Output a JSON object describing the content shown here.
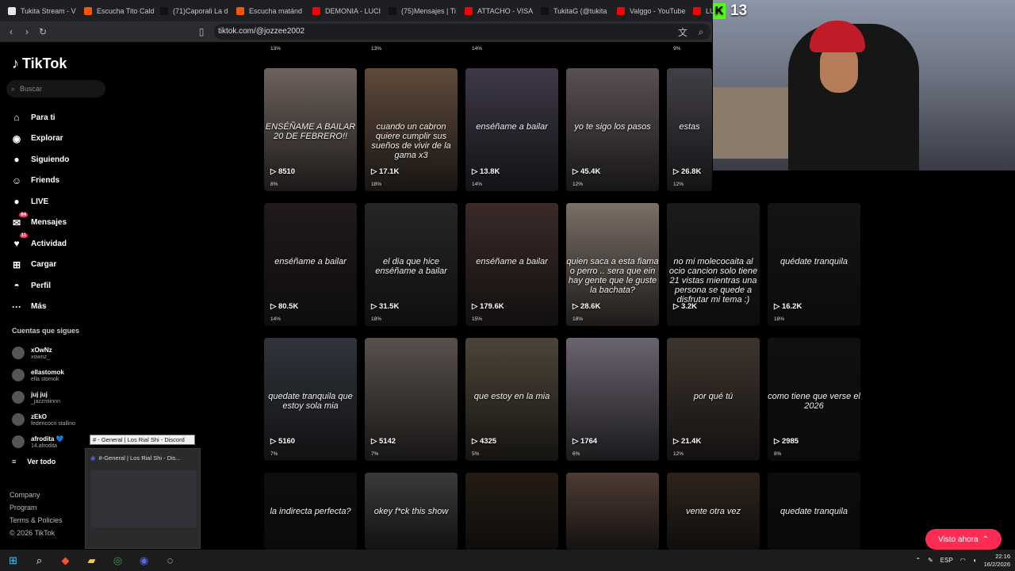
{
  "browser": {
    "tabs": [
      {
        "label": "Tukita Stream - V",
        "color": "#e6e6e6"
      },
      {
        "label": "Escucha Tito Cald",
        "color": "#ff5500"
      },
      {
        "label": "(71)Caporali La d",
        "color": "#111111"
      },
      {
        "label": "Escucha matánd",
        "color": "#ff5500"
      },
      {
        "label": "DEMONIA - LUCI",
        "color": "#ff0000"
      },
      {
        "label": "(75)Mensajes | Ti",
        "color": "#111111"
      },
      {
        "label": "ATTACHO - VISA",
        "color": "#ff0000"
      },
      {
        "label": "TukitaG (@tukita",
        "color": "#111111"
      },
      {
        "label": "Valggo - YouTube",
        "color": "#ff0000"
      },
      {
        "label": "LUAR",
        "color": "#ff0000"
      }
    ],
    "url": "tiktok.com/@jozzee2002"
  },
  "sidebar": {
    "logo": "TikTok",
    "search_placeholder": "Buscar",
    "menu": [
      {
        "label": "Para ti",
        "icon": "home-icon",
        "glyph": "⌂",
        "badge": ""
      },
      {
        "label": "Explorar",
        "icon": "compass-icon",
        "glyph": "◉",
        "badge": ""
      },
      {
        "label": "Siguiendo",
        "icon": "following-icon",
        "glyph": "●",
        "badge": ""
      },
      {
        "label": "Friends",
        "icon": "friends-icon",
        "glyph": "☺",
        "badge": ""
      },
      {
        "label": "LIVE",
        "icon": "live-icon",
        "glyph": "●",
        "badge": ""
      },
      {
        "label": "Mensajes",
        "icon": "messages-icon",
        "glyph": "✉",
        "badge": "64"
      },
      {
        "label": "Actividad",
        "icon": "activity-icon",
        "glyph": "♥",
        "badge": "11"
      },
      {
        "label": "Cargar",
        "icon": "upload-icon",
        "glyph": "⊞",
        "badge": ""
      },
      {
        "label": "Perfil",
        "icon": "profile-icon",
        "glyph": "◓",
        "badge": ""
      },
      {
        "label": "Más",
        "icon": "more-icon",
        "glyph": "···",
        "badge": ""
      }
    ],
    "following_title": "Cuentas que sigues",
    "following": [
      {
        "name": "xOwNz",
        "handle": "xownz_"
      },
      {
        "name": "ellastomok",
        "handle": "ella stomok"
      },
      {
        "name": "juj juj",
        "handle": "_jazzmiinnn"
      },
      {
        "name": "zEkO",
        "handle": "federicocri stallino"
      },
      {
        "name": "afrodita 💙",
        "handle": "14.afrodita"
      }
    ],
    "see_all": "Ver todo",
    "footer": [
      "Company",
      "Program",
      "Terms & Policies",
      "© 2026 TikTok"
    ]
  },
  "videos": [
    {
      "views": "8510",
      "pct": "8%",
      "caption": "ENSÉÑAME A BAILAR 20 DE FEBRERO!!",
      "bg": "#6f625d"
    },
    {
      "views": "17.1K",
      "pct": "18%",
      "caption": "cuando un cabron quiere cumplir sus sueños de vivir de la gama x3",
      "bg": "#5f4a3c"
    },
    {
      "views": "13.8K",
      "pct": "14%",
      "caption": "enséñame a bailar",
      "bg": "#3e3848"
    },
    {
      "views": "45.4K",
      "pct": "12%",
      "caption": "yo te sigo los pasos",
      "bg": "#5a5052"
    },
    {
      "views": "26.8K",
      "pct": "12%",
      "caption": "estas",
      "bg": "#433f47"
    },
    {
      "views": "80.5K",
      "pct": "14%",
      "caption": "enséñame a bailar",
      "bg": "#21191c"
    },
    {
      "views": "31.5K",
      "pct": "18%",
      "caption": "el dia que hice enséñame a bailar",
      "bg": "#262628"
    },
    {
      "views": "179.6K",
      "pct": "15%",
      "caption": "enséñame a bailar",
      "bg": "#3a2a28"
    },
    {
      "views": "28.6K",
      "pct": "18%",
      "caption": "quien saca a esta fiama o perro .. sera que ein hay gente que le guste la bachata?",
      "bg": "#7b6f66"
    },
    {
      "views": "3.2K",
      "pct": "",
      "caption": "no mi molecocaita al ocio cancion solo tiene 21 vistas mientras una persona se quede a disfrutar mi tema :)",
      "bg": "#1b1b1b"
    },
    {
      "views": "16.2K",
      "pct": "18%",
      "caption": "quédate tranquila",
      "bg": "#141414"
    },
    {
      "views": "5160",
      "pct": "7%",
      "caption": "quedate tranquila que estoy sola mia",
      "bg": "#30343b"
    },
    {
      "views": "5142",
      "pct": "7%",
      "caption": "",
      "bg": "#58504c"
    },
    {
      "views": "4325",
      "pct": "5%",
      "caption": "que estoy en la mia",
      "bg": "#4c4437"
    },
    {
      "views": "1764",
      "pct": "6%",
      "caption": "",
      "bg": "#6b6370"
    },
    {
      "views": "21.4K",
      "pct": "12%",
      "caption": "por qué tú",
      "bg": "#3e342e"
    },
    {
      "views": "2985",
      "pct": "8%",
      "caption": "como tiene que verse el 2026",
      "bg": "#101010"
    },
    {
      "views": "",
      "pct": "",
      "caption": "la indirecta perfecta?",
      "bg": "#0e0e0e"
    },
    {
      "views": "",
      "pct": "",
      "caption": "okey f*ck this show",
      "bg": "#3a3a3a"
    },
    {
      "views": "",
      "pct": "",
      "caption": "",
      "bg": "#241c14"
    },
    {
      "views": "",
      "pct": "",
      "caption": "",
      "bg": "#4d3b34"
    },
    {
      "views": "",
      "pct": "",
      "caption": "vente otra vez",
      "bg": "#2d231c"
    },
    {
      "views": "",
      "pct": "",
      "caption": "quedate tranquila",
      "bg": "#0c0c0c"
    }
  ],
  "top_strip": [
    "13%",
    "13%",
    "14%",
    "9%"
  ],
  "overlay": {
    "kick_counter": "13",
    "visto_ahora": "Visto ahora",
    "discord_tooltip": "# - General | Los Rial Shi - Discord",
    "discord_preview_title": "#-General | Los Rial Shi - Dis..."
  },
  "taskbar": {
    "lang": "ESP",
    "time": "22:16",
    "date": "16/2/2026"
  }
}
